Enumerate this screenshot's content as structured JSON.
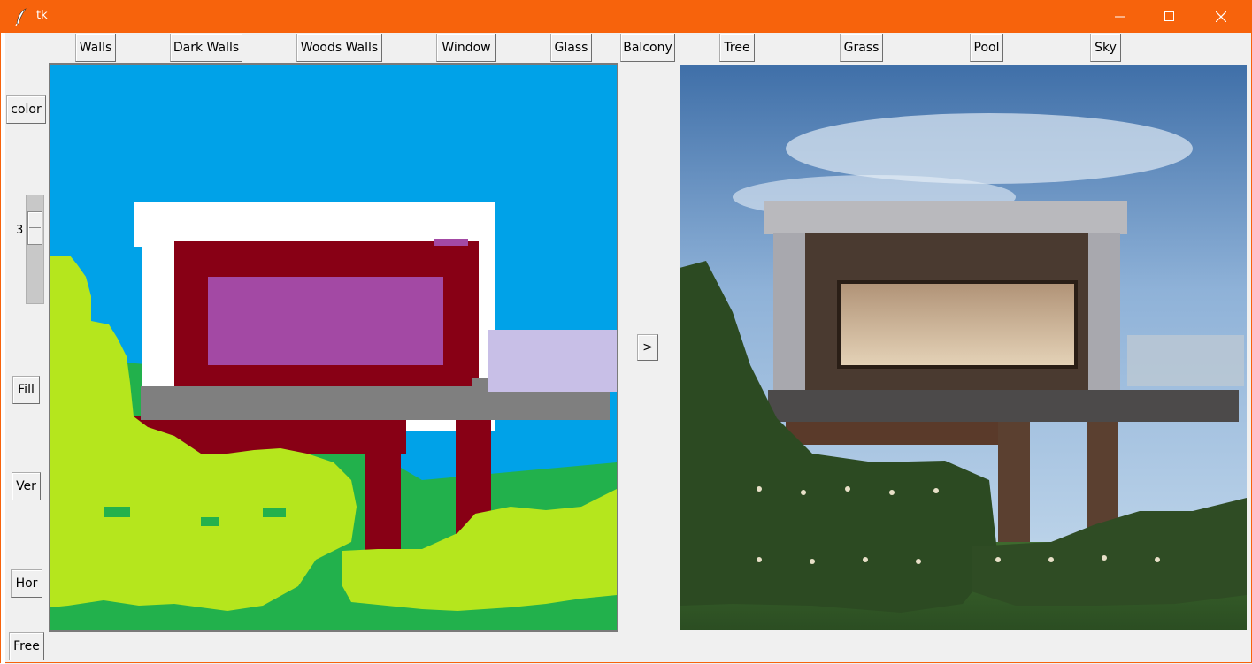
{
  "window": {
    "title": "tk",
    "titlebar_color": "#f7630c",
    "controls": {
      "minimize": "minimize-icon",
      "maximize": "maximize-icon",
      "close": "close-icon"
    }
  },
  "toolbar": {
    "walls": "Walls",
    "dark_walls": "Dark Walls",
    "woods_walls": "Woods Walls",
    "window": "Window",
    "glass": "Glass",
    "balcony": "Balcony",
    "tree": "Tree",
    "grass": "Grass",
    "pool": "Pool",
    "sky": "Sky"
  },
  "sidebar": {
    "color": "color",
    "brush_size": "3",
    "fill": "Fill",
    "ver": "Ver",
    "hor": "Hor",
    "free": "Free"
  },
  "generate": {
    "label": ">"
  },
  "palette": {
    "sky": "#00a2e8",
    "walls": "#ffffff",
    "dark_walls": "#880015",
    "window": "#a349a4",
    "glass": "#c8bfe7",
    "balcony": "#7f7f7f",
    "tree": "#b5e61d",
    "grass": "#22b14c"
  }
}
